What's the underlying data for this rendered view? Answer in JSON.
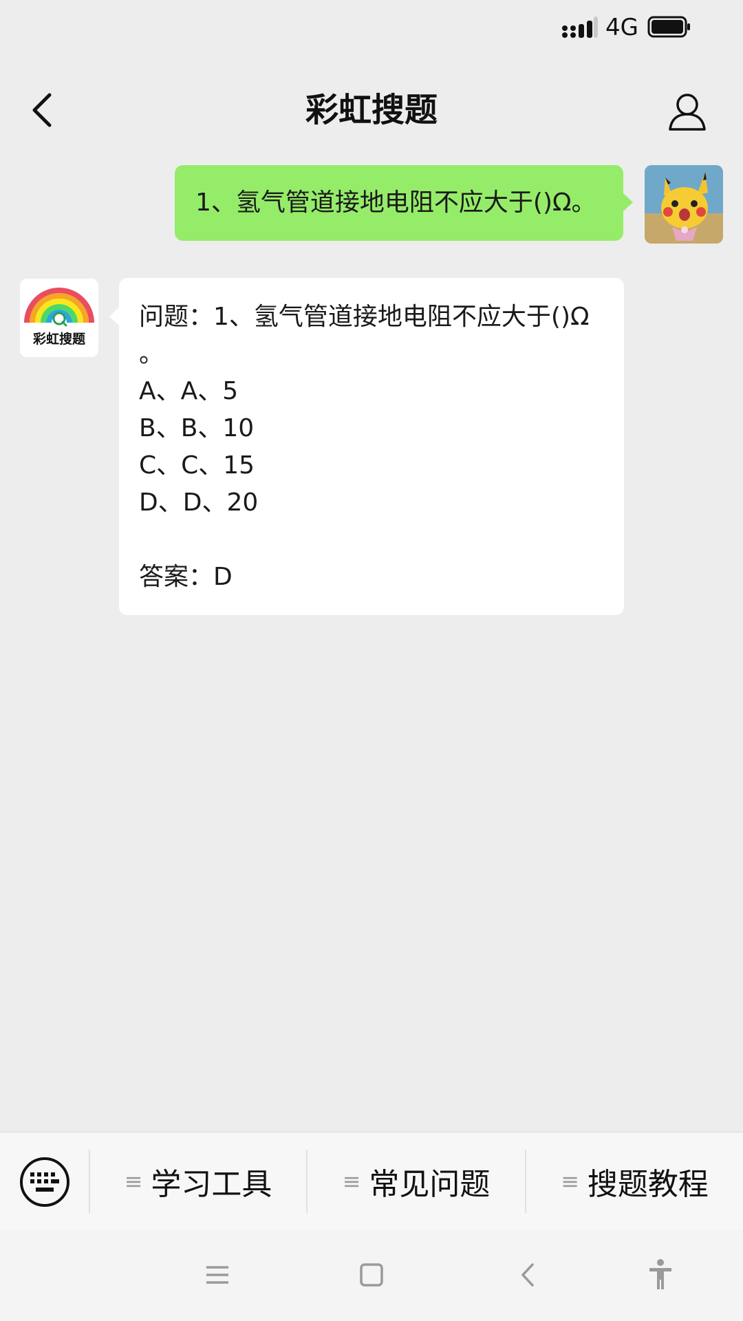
{
  "status_bar": {
    "network": "4G"
  },
  "header": {
    "title": "彩虹搜题"
  },
  "messages": {
    "user": {
      "text": "1、氢气管道接地电阻不应大于()Ω。"
    },
    "bot": {
      "avatar_label": "彩虹搜题",
      "lines": [
        "问题：1、氢气管道接地电阻不应大于()Ω",
        "。",
        "A、A、5",
        "B、B、10",
        "C、C、15",
        "D、D、20",
        "",
        "答案：D"
      ]
    }
  },
  "menu": {
    "items": [
      {
        "label": "学习工具"
      },
      {
        "label": "常见问题"
      },
      {
        "label": "搜题教程"
      }
    ]
  },
  "colors": {
    "background": "#ededed",
    "user_bubble": "#95ec69",
    "bot_bubble": "#ffffff",
    "rainbow": [
      "#e94d5f",
      "#f5a623",
      "#f8e71c",
      "#4cd964",
      "#2aa7e0"
    ]
  },
  "icons": [
    "signal-icon",
    "battery-icon",
    "back-icon",
    "profile-icon",
    "keyboard-icon",
    "menu-lines-icon",
    "nav-menu-icon",
    "nav-home-icon",
    "nav-back-icon",
    "accessibility-icon"
  ]
}
